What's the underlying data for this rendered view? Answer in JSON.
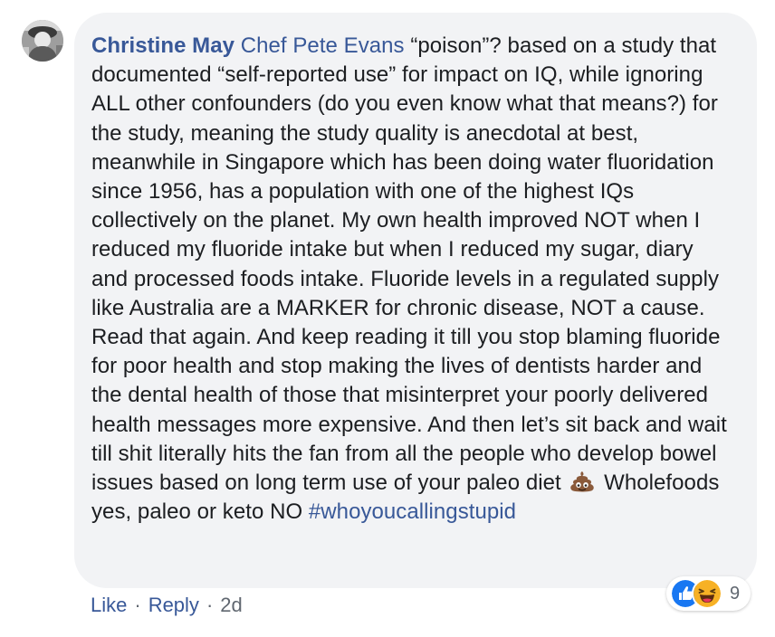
{
  "comment": {
    "author": "Christine May",
    "mention": "Chef Pete Evans",
    "body_part1": "“poison”? based on a study that documented “self-reported use” for impact on IQ, while ignoring ALL other confounders (do you even know what that means?) for the study, meaning the study quality is anecdotal at best, meanwhile in Singapore which has been doing water fluoridation since 1956, has a population with one of the highest IQs collectively on the planet. My own health improved NOT when I reduced my fluoride intake but when I reduced my sugar, diary and processed foods intake. Fluoride levels in a regulated supply like Australia are a MARKER for chronic disease, NOT a cause. Read that again. And keep reading it till you stop blaming fluoride for poor health and stop making the lives of dentists harder and the dental health of those that misinterpret your poorly delivered health messages more expensive. And then let’s sit back and wait till shit literally hits the fan from all the people who develop bowel issues based on long term use of your paleo diet",
    "emoji": "pile-of-poo-emoji",
    "body_part2": "Wholefoods yes, paleo or keto NO",
    "hashtag": "#whoyoucallingstupid"
  },
  "reactions": {
    "types": [
      "like-icon",
      "haha-icon"
    ],
    "count": "9"
  },
  "actions": {
    "like": "Like",
    "separator": "·",
    "reply": "Reply",
    "time": "2d"
  },
  "colors": {
    "link": "#385898",
    "text": "#1c1e21",
    "bubble": "#f2f3f5",
    "meta": "#606770",
    "like_blue": "#1877f2",
    "haha_yellow": "#f7b125"
  }
}
